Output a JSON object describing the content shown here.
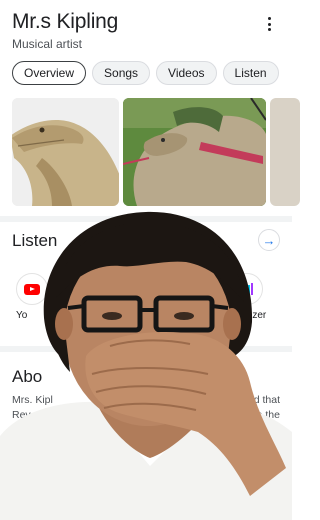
{
  "header": {
    "title": "Mr.s Kipling",
    "subtitle": "Musical artist",
    "menu_icon": "more-vert-icon"
  },
  "tabs": [
    {
      "label": "Overview",
      "active": true
    },
    {
      "label": "Songs",
      "active": false
    },
    {
      "label": "Videos",
      "active": false
    },
    {
      "label": "Listen",
      "active": false
    }
  ],
  "images": [
    {
      "name": "lizard-image"
    },
    {
      "name": "monitor-lizard-harness-image"
    },
    {
      "name": "partial-image"
    }
  ],
  "listen": {
    "title": "Listen",
    "arrow_icon": "arrow-right-icon",
    "services": [
      {
        "label": "Yo",
        "icon": "youtube-icon",
        "color": "#ff0000"
      },
      {
        "label": "Deezer",
        "icon": "deezer-icon",
        "color": "#a238ff"
      }
    ]
  },
  "about": {
    "title": "Abo",
    "line1_start": "Mrs. Kipl",
    "line1_end": "d that",
    "line2_start": "Rev",
    "line2_end": "to the"
  },
  "overlay": {
    "name": "person-covering-mouth-overlay"
  },
  "colors": {
    "accent": "#1a73e8",
    "chip_bg": "#f1f3f4",
    "text_secondary": "#4d5156"
  }
}
